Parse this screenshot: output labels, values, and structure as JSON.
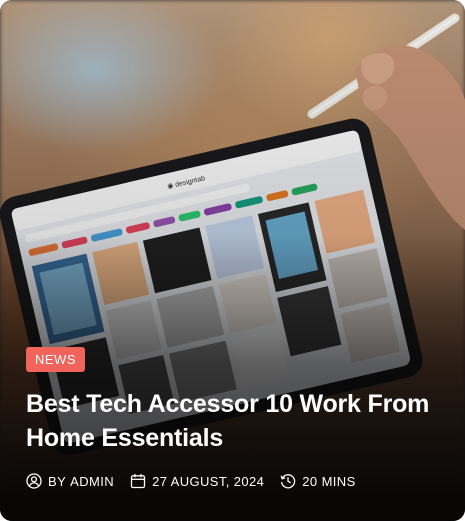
{
  "post": {
    "category": "NEWS",
    "title": "Best Tech Accessor 10 Work From Home Essentials",
    "author_prefix": "BY",
    "author": "ADMIN",
    "date": "27 AUGUST, 2024",
    "read_time": "20 MINS"
  },
  "icons": {
    "author": "user-circle-icon",
    "date": "calendar-icon",
    "read_time": "clock-icon"
  },
  "colors": {
    "badge": "#f0645c",
    "text": "#ffffff"
  }
}
